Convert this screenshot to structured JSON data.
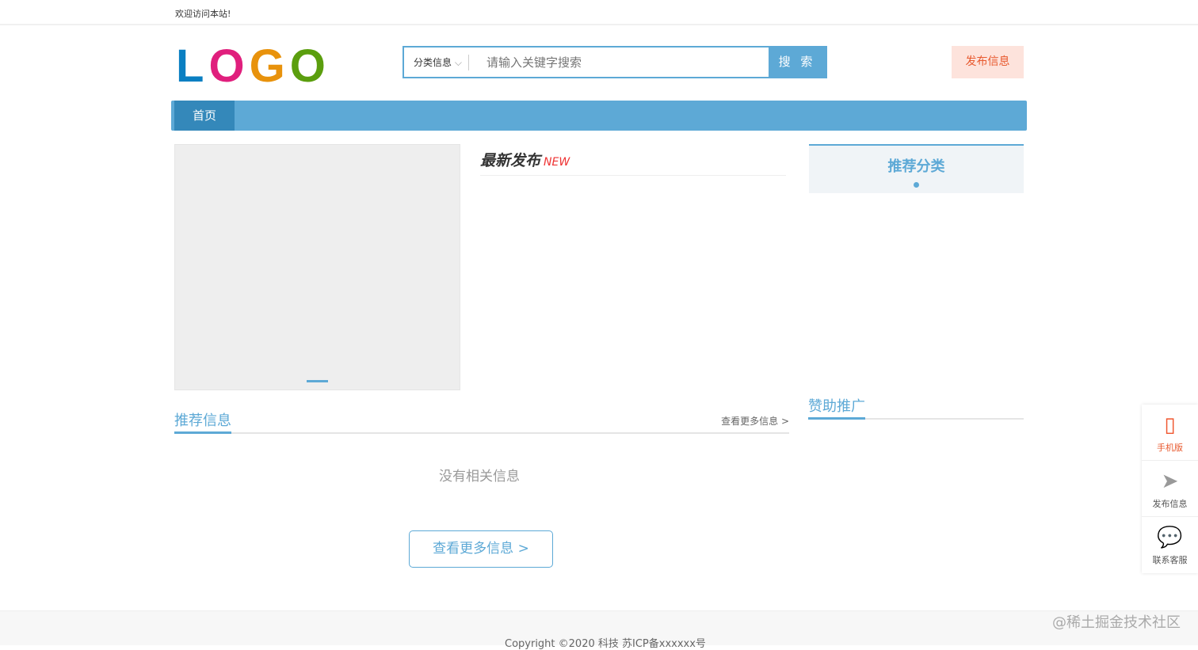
{
  "topbar": {
    "welcome": "欢迎访问本站!"
  },
  "logo": {
    "letters": [
      "L",
      "O",
      "G",
      "O"
    ],
    "colors": [
      "#0a7fc2",
      "#e01f7d",
      "#e8920c",
      "#5b9e0e"
    ]
  },
  "search": {
    "category": "分类信息",
    "placeholder": "请输入关键字搜索",
    "button": "搜 索"
  },
  "header": {
    "post_button": "发布信息"
  },
  "nav": {
    "items": [
      {
        "label": "首页"
      }
    ]
  },
  "latest": {
    "title": "最新发布",
    "badge": "NEW"
  },
  "recommend_category": {
    "title": "推荐分类"
  },
  "recommend": {
    "title": "推荐信息",
    "more": "查看更多信息 >",
    "empty": "没有相关信息",
    "more_button": "查看更多信息  >"
  },
  "sponsor": {
    "title": "赞助推广"
  },
  "side": [
    {
      "label": "手机版",
      "icon": "mobile-icon"
    },
    {
      "label": "发布信息",
      "icon": "paper-plane-icon"
    },
    {
      "label": "联系客服",
      "icon": "wechat-icon"
    }
  ],
  "footer": {
    "copyright": "Copyright ©2020 科技   苏ICP备xxxxxx号",
    "watermark": "@稀土掘金技术社区"
  }
}
